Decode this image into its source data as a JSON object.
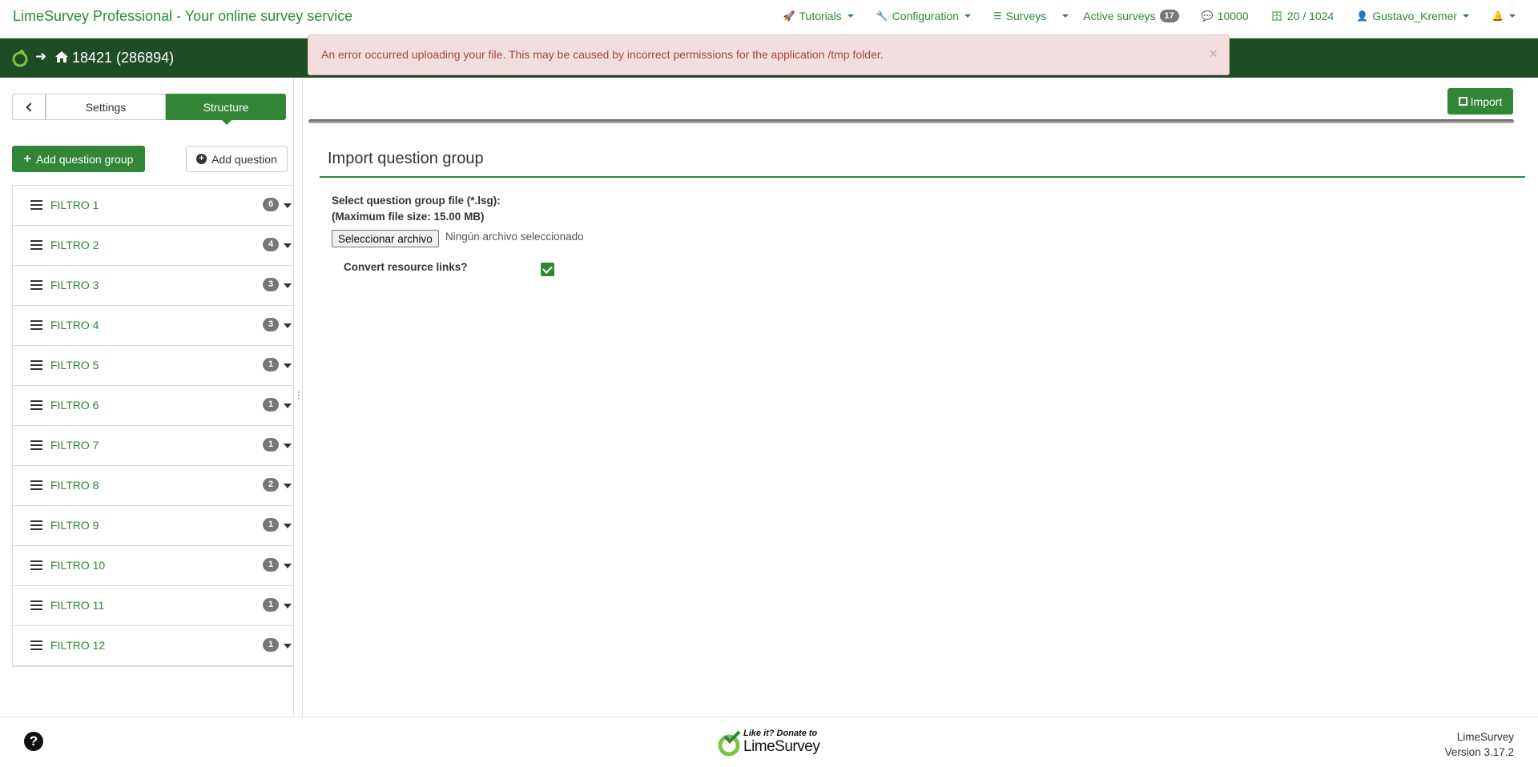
{
  "brand": "LimeSurvey Professional - Your online survey service",
  "nav": {
    "tutorials": "Tutorials",
    "configuration": "Configuration",
    "surveys": "Surveys",
    "active_surveys": "Active surveys",
    "active_count": "17",
    "responses": "10000",
    "storage": "20 / 1024",
    "user": "Gustavo_Kremer"
  },
  "survey_bar": {
    "title": "18421 (286894)"
  },
  "alert": {
    "message": "An error occurred uploading your file. This may be caused by incorrect permissions for the application /tmp folder.",
    "close": "×"
  },
  "sidebar": {
    "tabs": {
      "settings": "Settings",
      "structure": "Structure"
    },
    "add_group": "Add question group",
    "add_question": "Add question",
    "groups": [
      {
        "name": "FILTRO 1",
        "count": "6"
      },
      {
        "name": "FILTRO 2",
        "count": "4"
      },
      {
        "name": "FILTRO 3",
        "count": "3"
      },
      {
        "name": "FILTRO 4",
        "count": "3"
      },
      {
        "name": "FILTRO 5",
        "count": "1"
      },
      {
        "name": "FILTRO 6",
        "count": "1"
      },
      {
        "name": "FILTRO 7",
        "count": "1"
      },
      {
        "name": "FILTRO 8",
        "count": "2"
      },
      {
        "name": "FILTRO 9",
        "count": "1"
      },
      {
        "name": "FILTRO 10",
        "count": "1"
      },
      {
        "name": "FILTRO 11",
        "count": "1"
      },
      {
        "name": "FILTRO 12",
        "count": "1"
      }
    ]
  },
  "main": {
    "import_button": "Import",
    "heading": "Import question group",
    "file_label_1": "Select question group file (*.lsg):",
    "file_label_2": "(Maximum file size: 15.00 MB)",
    "file_button": "Seleccionar archivo",
    "file_status": "Ningún archivo seleccionado",
    "convert_label": "Convert resource links?",
    "convert_checked": true
  },
  "footer": {
    "donate_line1": "Like it? Donate to",
    "donate_line2": "LimeSurvey",
    "product": "LimeSurvey",
    "version": "Version 3.17.2"
  },
  "colors": {
    "accent": "#328637",
    "dark_green": "#1e4d23",
    "alert_bg": "#f2dede",
    "alert_text": "#a94442"
  }
}
